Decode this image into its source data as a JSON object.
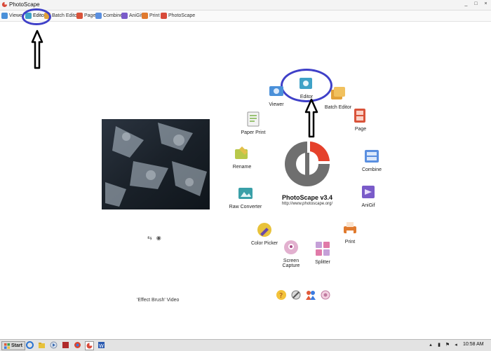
{
  "window": {
    "title": "PhotoScape",
    "controls": [
      "_",
      "□",
      "×"
    ]
  },
  "tabs": [
    {
      "label": "Viewer",
      "icon": "viewer-icon",
      "color": "#4a90d9"
    },
    {
      "label": "Editor",
      "icon": "editor-icon",
      "color": "#3fa2c7"
    },
    {
      "label": "Batch Editor",
      "icon": "batch-editor-icon",
      "color": "#e2a23a"
    },
    {
      "label": "Page",
      "icon": "page-icon",
      "color": "#d9533a"
    },
    {
      "label": "Combine",
      "icon": "combine-icon",
      "color": "#5a8fe0"
    },
    {
      "label": "AniGif",
      "icon": "anigif-icon",
      "color": "#7a5bc9"
    },
    {
      "label": "Print",
      "icon": "print-icon",
      "color": "#e07a2e"
    },
    {
      "label": "PhotoScape",
      "icon": "photoscape-icon",
      "color": "#d84a3a"
    }
  ],
  "home": {
    "caption": "'Effect Brush' Video",
    "brand": "PhotoScape v3.4",
    "url": "http://www.photoscape.org/",
    "modules": [
      {
        "label": "Editor",
        "icon": "editor-icon",
        "color": "#3fa2c7"
      },
      {
        "label": "Batch Editor",
        "icon": "batch-editor-icon",
        "color": "#e2a23a"
      },
      {
        "label": "Page",
        "icon": "page-icon",
        "color": "#d9533a"
      },
      {
        "label": "Combine",
        "icon": "combine-icon",
        "color": "#5a8fe0"
      },
      {
        "label": "AniGif",
        "icon": "anigif-icon",
        "color": "#7a5bc9"
      },
      {
        "label": "Print",
        "icon": "print-icon",
        "color": "#e07a2e"
      },
      {
        "label": "Splitter",
        "icon": "splitter-icon",
        "color": "#c5a0d8"
      },
      {
        "label": "Screen Capture",
        "icon": "screen-capture-icon",
        "color": "#e2b0cf"
      },
      {
        "label": "Color Picker",
        "icon": "color-picker-icon",
        "color": "#e8c23a"
      },
      {
        "label": "Raw Converter",
        "icon": "raw-converter-icon",
        "color": "#3aa0a8"
      },
      {
        "label": "Rename",
        "icon": "rename-icon",
        "color": "#b8c84a"
      },
      {
        "label": "Paper Print",
        "icon": "paper-print-icon",
        "color": "#7cb34a"
      },
      {
        "label": "Viewer",
        "icon": "viewer-icon",
        "color": "#4a90d9"
      }
    ]
  },
  "taskbar": {
    "start_label": "Start",
    "clock": "10:58 AM"
  },
  "accent": {
    "annotation": "#3f40c8",
    "logo_red": "#e5412b",
    "logo_gray": "#6f6f6f"
  }
}
